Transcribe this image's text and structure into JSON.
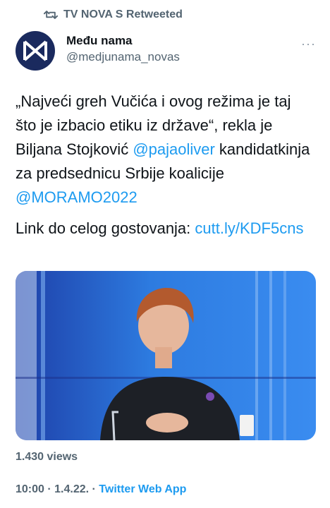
{
  "retweet": {
    "label": "TV NOVA S Retweeted",
    "icon": "retweet-icon"
  },
  "author": {
    "display_name": "Među nama",
    "handle": "@medjunama_novas",
    "avatar_color": "#1a2a5e",
    "more_label": "···"
  },
  "tweet": {
    "line1_part1": "„Najveći greh Vučića i ovog režima je taj što je izbacio etiku iz države“, rekla je Biljana Stojković ",
    "mention1": "@pajaoliver",
    "line1_part2": " kandidatkinja za predsednicu Srbije koalicije ",
    "mention2": "@MORAMO2022",
    "line2_part1": "Link do celog gostovanja: ",
    "link": "cutt.ly/KDF5cns"
  },
  "stats": {
    "views": "1.430 views"
  },
  "meta": {
    "time": "10:00",
    "date": "1.4.22.",
    "app": "Twitter Web App",
    "sep": " · "
  },
  "colors": {
    "accent": "#1d9bf0",
    "muted": "#536471",
    "text": "#0f1419"
  }
}
